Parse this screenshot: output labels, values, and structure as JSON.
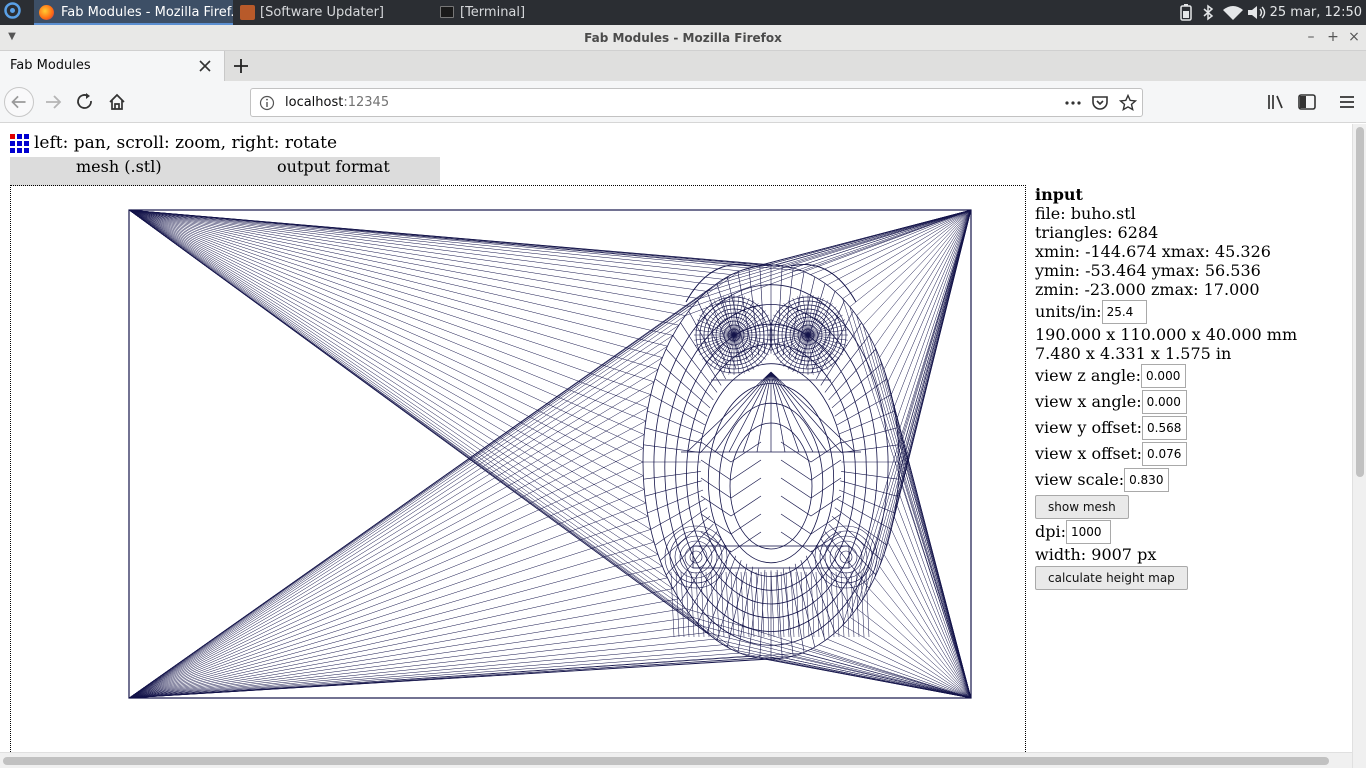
{
  "taskbar": {
    "tasks": [
      {
        "label": "Fab Modules - Mozilla Firef...",
        "icon": "firefox-icon",
        "active": true
      },
      {
        "label": "[Software Updater]",
        "icon": "software-updater-icon",
        "active": false
      },
      {
        "label": "[Terminal]",
        "icon": "terminal-icon",
        "active": false
      }
    ],
    "tray_icons": [
      "battery-icon",
      "bluetooth-icon",
      "wifi-icon",
      "volume-icon"
    ],
    "clock": "25 mar, 12:50"
  },
  "window": {
    "title": "Fab Modules - Mozilla Firefox"
  },
  "browser": {
    "tab_title": "Fab Modules",
    "url_host": "localhost",
    "url_port": ":12345"
  },
  "page": {
    "help": "left: pan, scroll: zoom, right: rotate",
    "menu": {
      "mesh": "mesh (.stl)",
      "output": "output format"
    },
    "panel": {
      "heading": "input",
      "file": "file: buho.stl",
      "triangles": "triangles: 6284",
      "x_range": "xmin: -144.674 xmax: 45.326",
      "y_range": "ymin: -53.464 ymax: 56.536",
      "z_range": "zmin: -23.000 zmax: 17.000",
      "units_label": "units/in:",
      "units_value": "25.4",
      "size_mm": "190.000 x 110.000 x 40.000 mm",
      "size_in": "7.480 x 4.331 x 1.575 in",
      "view_z_angle_label": "view z angle:",
      "view_z_angle_value": "0.000",
      "view_x_angle_label": "view x angle:",
      "view_x_angle_value": "0.000",
      "view_y_offset_label": "view y offset:",
      "view_y_offset_value": "0.568",
      "view_x_offset_label": "view x offset:",
      "view_x_offset_value": "0.076",
      "view_scale_label": "view scale:",
      "view_scale_value": "0.830",
      "show_mesh_label": "show mesh",
      "dpi_label": "dpi:",
      "dpi_value": "1000",
      "width": "width: 9007 px",
      "calc_label": "calculate height map"
    },
    "mesh_color": "#14144a"
  }
}
